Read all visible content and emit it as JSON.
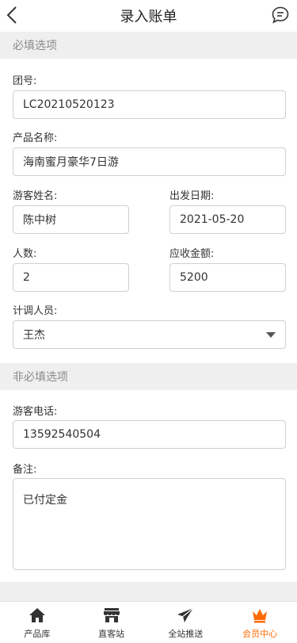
{
  "header": {
    "title": "录入账单",
    "back_icon": "chevron-left-icon",
    "message_icon": "chat-bubble-icon"
  },
  "required_section": {
    "title": "必填选项"
  },
  "form": {
    "group_no": {
      "label": "团号:",
      "value": "LC20210520123"
    },
    "product_name": {
      "label": "产品名称:",
      "value": "海南蜜月豪华7日游"
    },
    "guest_name": {
      "label": "游客姓名:",
      "value": "陈中树"
    },
    "departure_date": {
      "label": "出发日期:",
      "value": "2021-05-20"
    },
    "people_count": {
      "label": "人数:",
      "value": "2"
    },
    "receivable_amount": {
      "label": "应收金额:",
      "value": "5200"
    },
    "coordinator": {
      "label": "计调人员:",
      "value": "王杰"
    }
  },
  "optional_section": {
    "title": "非必填选项"
  },
  "optional": {
    "guest_phone": {
      "label": "游客电话:",
      "value": "13592540504"
    },
    "remark": {
      "label": "备注:",
      "value": "已付定金"
    }
  },
  "tabbar": {
    "items": [
      {
        "label": "产品库",
        "icon": "home-icon"
      },
      {
        "label": "直客站",
        "icon": "store-icon"
      },
      {
        "label": "全站推送",
        "icon": "send-icon"
      },
      {
        "label": "会员中心",
        "icon": "crown-icon",
        "active": true
      }
    ]
  },
  "colors": {
    "accent": "#ff6a00",
    "section_bg": "#efefef",
    "border": "#cfcfcf"
  }
}
